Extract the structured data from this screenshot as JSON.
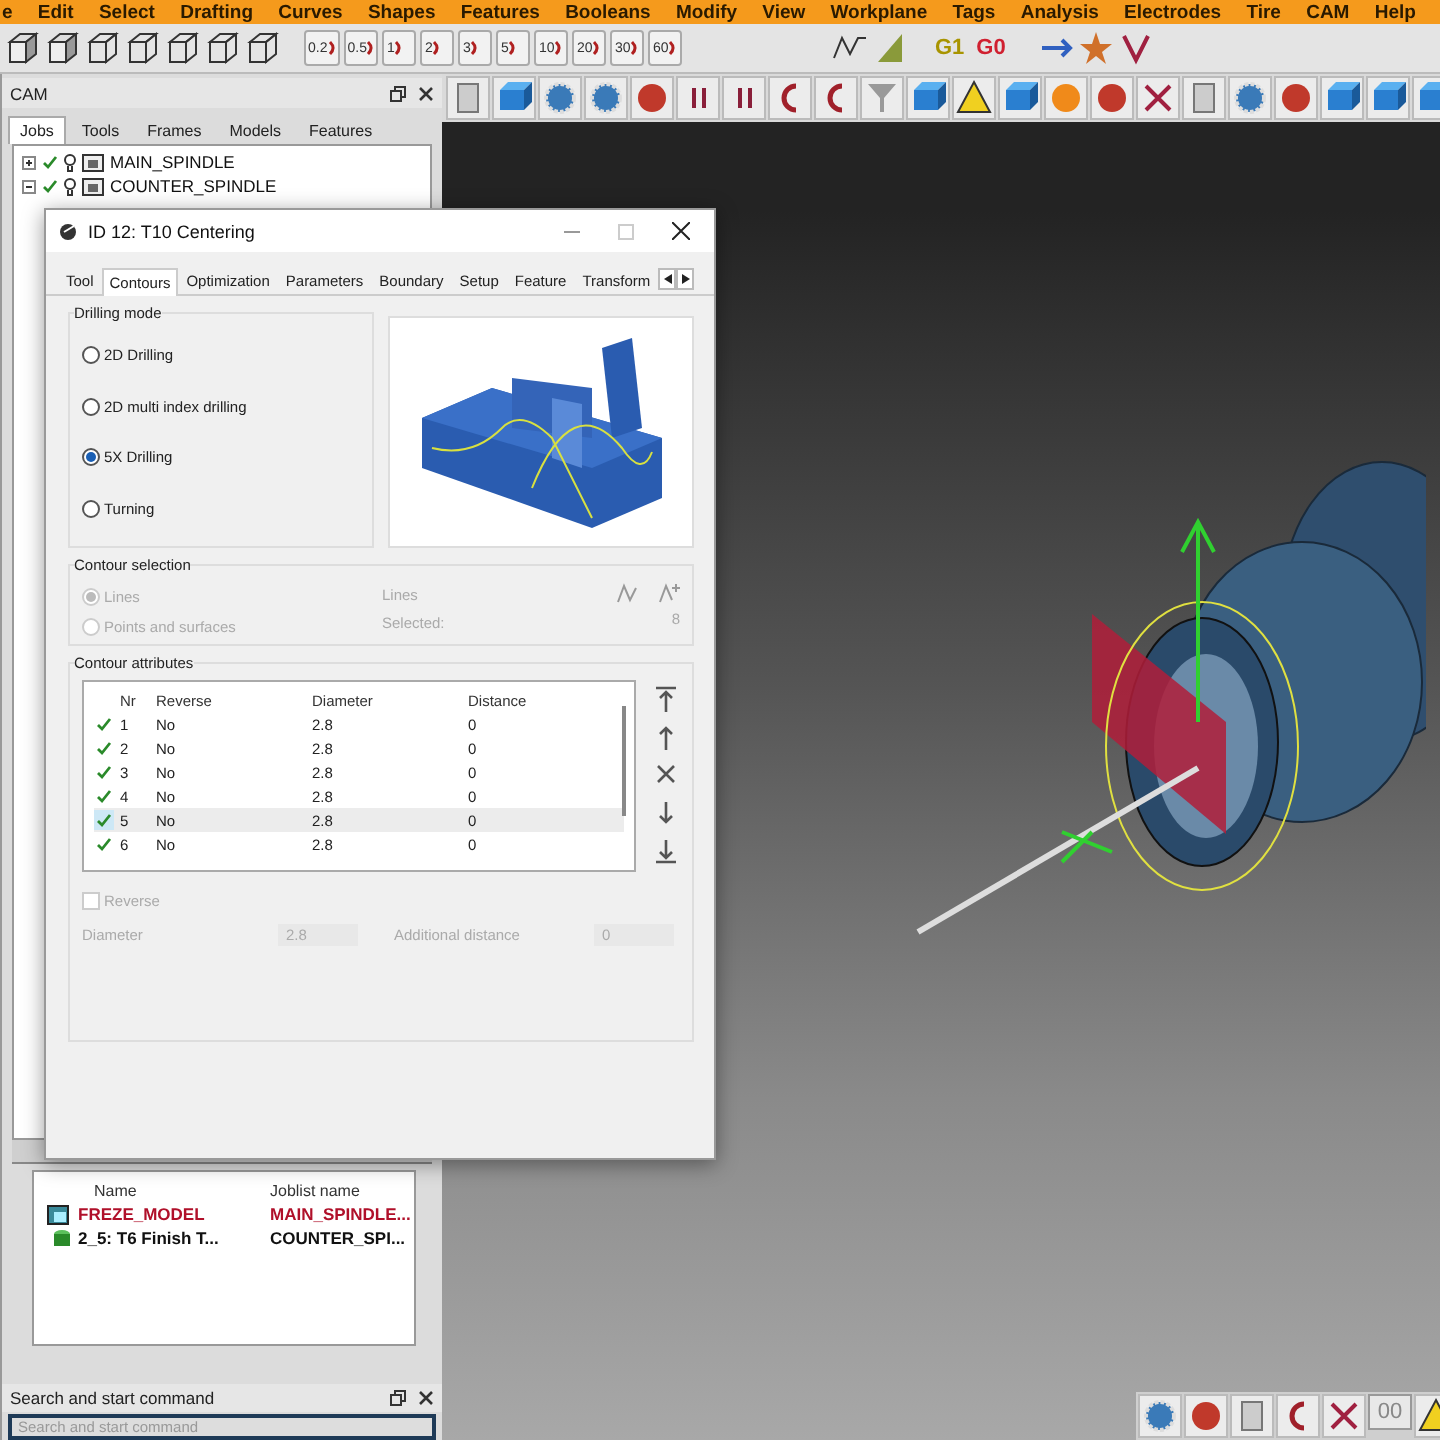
{
  "menu": [
    "e",
    "Edit",
    "Select",
    "Drafting",
    "Curves",
    "Shapes",
    "Features",
    "Booleans",
    "Modify",
    "View",
    "Workplane",
    "Tags",
    "Analysis",
    "Electrodes",
    "Tire",
    "CAM",
    "Help"
  ],
  "toolbar": {
    "scale_buttons": [
      "0.2",
      "0.5",
      "1",
      "2",
      "3",
      "5",
      "10",
      "20",
      "30",
      "60"
    ],
    "g_buttons": [
      "G1",
      "G0"
    ]
  },
  "cam_panel": {
    "title": "CAM",
    "tabs": [
      {
        "label": "Jobs",
        "selected": true
      },
      {
        "label": "Tools",
        "selected": false
      },
      {
        "label": "Frames",
        "selected": false
      },
      {
        "label": "Models",
        "selected": false
      },
      {
        "label": "Features",
        "selected": false
      }
    ],
    "tree": [
      {
        "label": "MAIN_SPINDLE",
        "checked": true,
        "expanded": false
      },
      {
        "label": "COUNTER_SPINDLE",
        "checked": true,
        "expanded": true
      }
    ],
    "list": {
      "columns": [
        "Name",
        "Joblist name"
      ],
      "rows": [
        {
          "kind": "model",
          "name": "FREZE_MODEL",
          "joblist": "MAIN_SPINDLE...",
          "color": "#b0102a"
        },
        {
          "kind": "job",
          "name": "2_5: T6 Finish T...",
          "joblist": "COUNTER_SPI...",
          "color": "#111111"
        }
      ]
    }
  },
  "search_panel": {
    "title": "Search and start command",
    "placeholder": "Search and start command"
  },
  "dialog": {
    "title": "ID 12: T10 Centering",
    "tabs": [
      {
        "label": "Tool",
        "selected": false
      },
      {
        "label": "Contours",
        "selected": true
      },
      {
        "label": "Optimization",
        "selected": false
      },
      {
        "label": "Parameters",
        "selected": false
      },
      {
        "label": "Boundary",
        "selected": false
      },
      {
        "label": "Setup",
        "selected": false
      },
      {
        "label": "Feature",
        "selected": false
      },
      {
        "label": "Transform",
        "selected": false
      }
    ],
    "drilling_mode": {
      "title": "Drilling mode",
      "options": [
        {
          "label": "2D Drilling",
          "selected": false
        },
        {
          "label": "2D multi index drilling",
          "selected": false
        },
        {
          "label": "5X Drilling",
          "selected": true
        },
        {
          "label": "Turning",
          "selected": false
        }
      ]
    },
    "contour_selection": {
      "title": "Contour selection",
      "options": [
        {
          "label": "Lines",
          "selected": true,
          "disabled": true
        },
        {
          "label": "Points and surfaces",
          "selected": false,
          "disabled": true
        }
      ],
      "type_label": "Lines",
      "selected_label": "Selected:",
      "selected_count": "8"
    },
    "contour_attributes": {
      "title": "Contour attributes",
      "columns": [
        "Nr",
        "Reverse",
        "Diameter",
        "Distance"
      ],
      "rows": [
        {
          "checked": true,
          "selected": false,
          "nr": "1",
          "reverse": "No",
          "diameter": "2.8",
          "distance": "0"
        },
        {
          "checked": true,
          "selected": false,
          "nr": "2",
          "reverse": "No",
          "diameter": "2.8",
          "distance": "0"
        },
        {
          "checked": true,
          "selected": false,
          "nr": "3",
          "reverse": "No",
          "diameter": "2.8",
          "distance": "0"
        },
        {
          "checked": true,
          "selected": false,
          "nr": "4",
          "reverse": "No",
          "diameter": "2.8",
          "distance": "0"
        },
        {
          "checked": true,
          "selected": true,
          "nr": "5",
          "reverse": "No",
          "diameter": "2.8",
          "distance": "0"
        },
        {
          "checked": true,
          "selected": false,
          "nr": "6",
          "reverse": "No",
          "diameter": "2.8",
          "distance": "0"
        }
      ]
    },
    "reverse": {
      "label": "Reverse",
      "checked": false,
      "disabled": true
    },
    "diameter": {
      "label": "Diameter",
      "value": "2.8",
      "disabled": true
    },
    "additional_distance": {
      "label": "Additional distance",
      "value": "0",
      "disabled": true
    }
  },
  "view_toolbar": {
    "zoom_label": "00"
  }
}
